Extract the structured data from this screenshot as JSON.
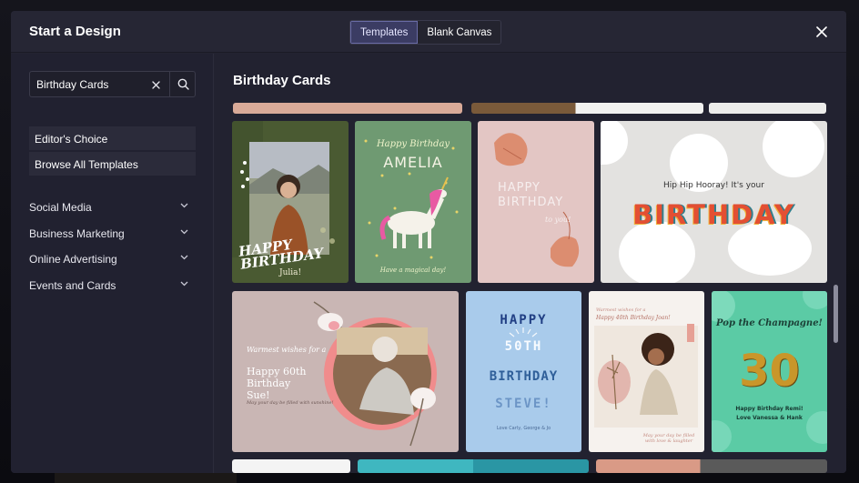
{
  "header": {
    "title": "Start a Design",
    "tabs": [
      {
        "label": "Templates",
        "active": true
      },
      {
        "label": "Blank Canvas",
        "active": false
      }
    ]
  },
  "sidebar": {
    "search": {
      "value": "Birthday Cards"
    },
    "quick_links": [
      {
        "label": "Editor's Choice"
      },
      {
        "label": "Browse All Templates"
      }
    ],
    "categories": [
      {
        "label": "Social Media"
      },
      {
        "label": "Business Marketing"
      },
      {
        "label": "Online Advertising"
      },
      {
        "label": "Events and Cards"
      }
    ]
  },
  "main": {
    "title": "Birthday Cards",
    "templates": [
      {
        "text": "HAPPY BIRTHDAY",
        "sub": "Julia!"
      },
      {
        "text": "Happy Birthday",
        "name": "AMELIA",
        "sub": "Have a magical day!"
      },
      {
        "text": "HAPPY BIRTHDAY",
        "sub": "to you!"
      },
      {
        "text": "Hip Hip Hooray! It's your",
        "big": "BIRTHDAY"
      },
      {
        "text": "Warmest wishes for a",
        "big": "Happy 60th Birthday Sue!",
        "sub": "May your day be filled with sunshine!"
      },
      {
        "text": "HAPPY",
        "line2": "50TH",
        "line3": "BIRTHDAY",
        "line4": "STEVE!",
        "sub": "Love Carly, George & Jo"
      },
      {
        "text": "Warmest wishes for a",
        "big": "Happy 40th Birthday Joan!",
        "sub": "May your day be filled with love & laughter"
      },
      {
        "text": "Pop the Champagne!",
        "big": "30",
        "sub": "Happy Birthday Remi!",
        "sub2": "Love Vanessa & Hank"
      }
    ]
  },
  "colors": {
    "accent": "#3b3c63",
    "modal_bg": "#232330",
    "card_green_dark": "#4a5a32",
    "card_green": "#6f9a72",
    "card_pink": "#e3c6c4",
    "card_grey": "#e3e2e0",
    "card_mauve": "#c9b6b4",
    "card_blue": "#a9cbeb",
    "card_mint": "#5bcba5"
  }
}
